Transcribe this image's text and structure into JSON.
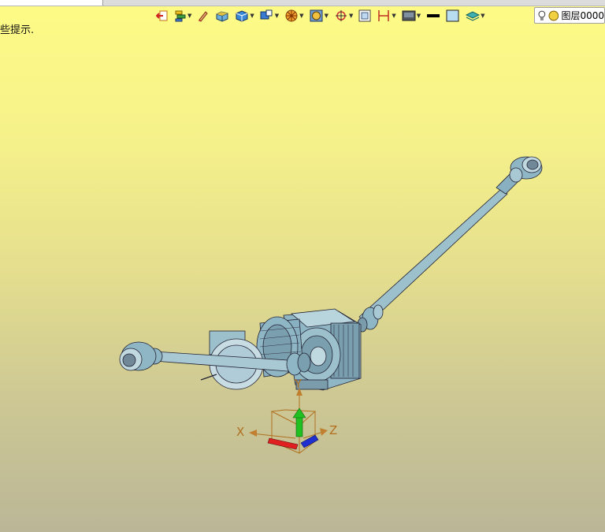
{
  "tab": {
    "title": ""
  },
  "status": {
    "hint": "些提示."
  },
  "layer": {
    "name": "图层0000"
  },
  "axes": {
    "x": "X",
    "y": "Y",
    "z": "Z"
  },
  "colors": {
    "bg_top": "#fefb86",
    "bg_bottom": "#bbb697",
    "model_fill": "#8fb6c5",
    "model_stroke": "#223",
    "axis_x": "#e02020",
    "axis_y": "#20c020",
    "axis_z": "#2030d0"
  },
  "toolbar": {
    "buttons": [
      {
        "icon": "exit-icon",
        "dropdown": false
      },
      {
        "icon": "layers-stack-icon",
        "dropdown": true
      },
      {
        "icon": "pencil-icon",
        "dropdown": false
      },
      {
        "icon": "box-solid-icon",
        "dropdown": false
      },
      {
        "icon": "cube-view-icon",
        "dropdown": true
      },
      {
        "icon": "view-orient-icon",
        "dropdown": true
      },
      {
        "icon": "render-style-icon",
        "dropdown": true
      },
      {
        "icon": "section-view-icon",
        "dropdown": true
      },
      {
        "icon": "snap-target-icon",
        "dropdown": true
      },
      {
        "icon": "fit-window-icon",
        "dropdown": false
      },
      {
        "icon": "dimension-icon",
        "dropdown": true
      },
      {
        "icon": "display-mode-icon",
        "dropdown": true
      },
      {
        "icon": "line-color-icon",
        "dropdown": false
      },
      {
        "icon": "fill-color-icon",
        "dropdown": false
      },
      {
        "icon": "layer-icon",
        "dropdown": true
      }
    ]
  }
}
